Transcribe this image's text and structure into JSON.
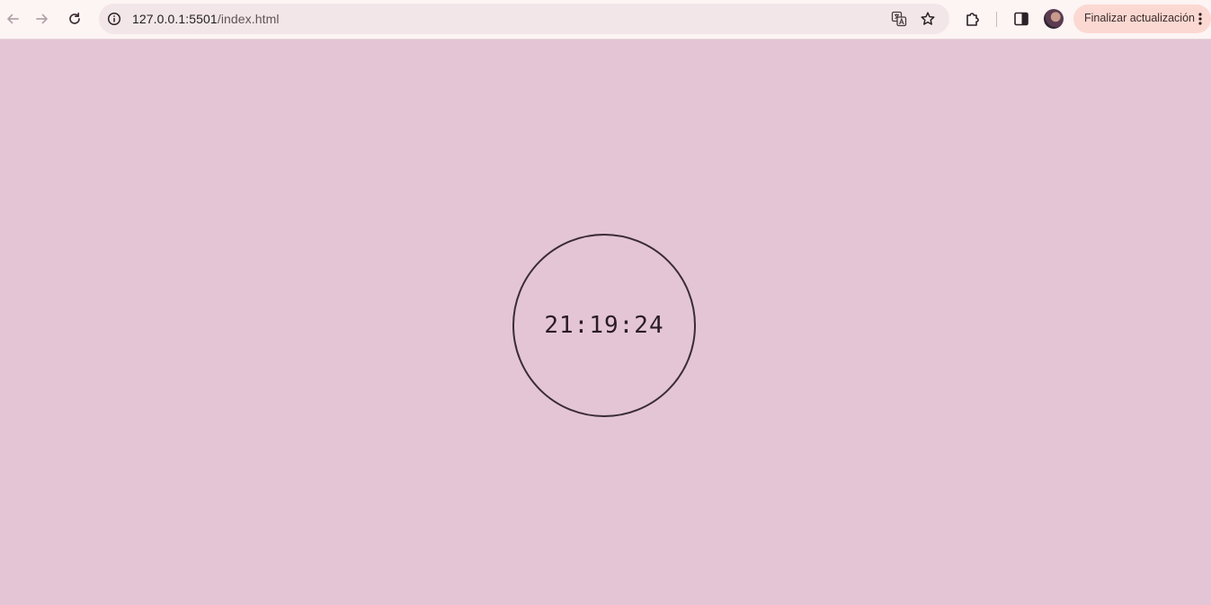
{
  "browser": {
    "url_host": "127.0.0.1:5501",
    "url_path": "/index.html",
    "update_button_label": "Finalizar actualización"
  },
  "icons": {
    "back": "arrow-left-icon",
    "forward": "arrow-right-icon",
    "reload": "reload-icon",
    "site_info": "info-icon",
    "translate": "translate-icon",
    "bookmark": "star-icon",
    "extensions": "puzzle-icon",
    "side_panel": "side-panel-icon",
    "menu": "kebab-icon"
  },
  "colors": {
    "page_background": "#e4c5d6",
    "toolbar_background": "#fdf4f4",
    "omnibox_background": "#f2e6e8",
    "update_button_background": "#fbd9d2",
    "clock_border": "#3a2c38"
  },
  "page": {
    "clock_time": "21:19:24"
  }
}
